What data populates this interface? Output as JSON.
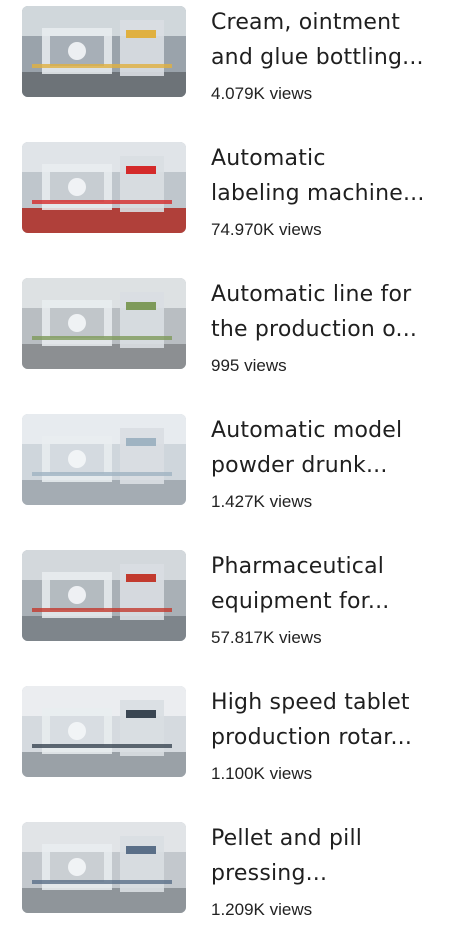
{
  "videos": [
    {
      "title_lines": [
        "Cream, ointment",
        "and glue bottling..."
      ],
      "views": "4.079K views",
      "thumb": {
        "base": "#9aa3ab",
        "accent": "#e0b040",
        "floor": "#6d7378",
        "light": "#e7ecef"
      }
    },
    {
      "title_lines": [
        "Automatic",
        "labeling machine..."
      ],
      "views": "74.970K views",
      "thumb": {
        "base": "#bfc6cc",
        "accent": "#d42a2a",
        "floor": "#b0403a",
        "light": "#eef1f3"
      }
    },
    {
      "title_lines": [
        "Automatic line for",
        "the production o..."
      ],
      "views": "995 views",
      "thumb": {
        "base": "#b9bec2",
        "accent": "#7e9a5a",
        "floor": "#8c8f92",
        "light": "#eceff1"
      }
    },
    {
      "title_lines": [
        "Automatic model",
        "powder drunk..."
      ],
      "views": "1.427K views",
      "thumb": {
        "base": "#cfd6dc",
        "accent": "#9fb3c2",
        "floor": "#a4acb3",
        "light": "#f1f4f6"
      }
    },
    {
      "title_lines": [
        "Pharmaceutical",
        "equipment for..."
      ],
      "views": "57.817K views",
      "thumb": {
        "base": "#a9b0b6",
        "accent": "#c23a2e",
        "floor": "#7e858b",
        "light": "#e6eaed"
      }
    },
    {
      "title_lines": [
        "High speed tablet",
        "production rotar..."
      ],
      "views": "1.100K views",
      "thumb": {
        "base": "#d5dadf",
        "accent": "#3a4652",
        "floor": "#9aa1a7",
        "light": "#f3f5f7"
      }
    },
    {
      "title_lines": [
        "Pellet and pill",
        "pressing..."
      ],
      "views": "1.209K views",
      "thumb": {
        "base": "#c3c8cd",
        "accent": "#5a6f88",
        "floor": "#8f959a",
        "light": "#eef0f2"
      }
    }
  ]
}
